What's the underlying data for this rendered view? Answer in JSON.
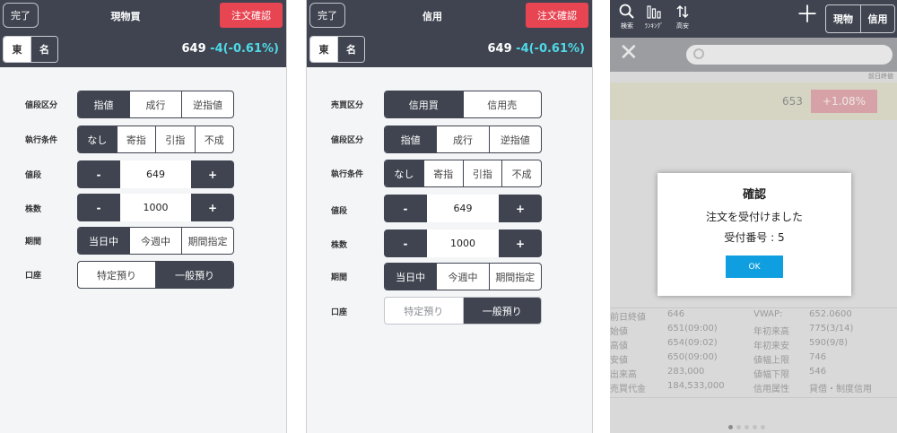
{
  "screen1": {
    "done": "完了",
    "title": "現物買",
    "confirm": "注文確認",
    "exchange": {
      "tse": "東",
      "nse": "名"
    },
    "price": {
      "last": "649",
      "change": "-4(-0.61%)"
    },
    "labels": {
      "price_type": "値段区分",
      "condition": "執行条件",
      "price": "値段",
      "quantity": "株数",
      "period": "期間",
      "account": "口座"
    },
    "price_type": [
      "指値",
      "成行",
      "逆指値"
    ],
    "condition": [
      "なし",
      "寄指",
      "引指",
      "不成"
    ],
    "price_value": "649",
    "quantity_value": "1000",
    "minus": "-",
    "plus": "+",
    "period": [
      "当日中",
      "今週中",
      "期間指定"
    ],
    "account": [
      "特定預り",
      "一般預り"
    ]
  },
  "screen2": {
    "done": "完了",
    "title": "信用",
    "confirm": "注文確認",
    "exchange": {
      "tse": "東",
      "nse": "名"
    },
    "price": {
      "last": "649",
      "change": "-4(-0.61%)"
    },
    "labels": {
      "side": "売買区分",
      "price_type": "値段区分",
      "condition": "執行条件",
      "price": "値段",
      "quantity": "株数",
      "period": "期間",
      "account": "口座"
    },
    "side": [
      "信用買",
      "信用売"
    ],
    "price_type": [
      "指値",
      "成行",
      "逆指値"
    ],
    "condition": [
      "なし",
      "寄指",
      "引指",
      "不成"
    ],
    "price_value": "649",
    "quantity_value": "1000",
    "minus": "-",
    "plus": "+",
    "period": [
      "当日中",
      "今週中",
      "期間指定"
    ],
    "account": [
      "特定預り",
      "一般預り"
    ]
  },
  "screen3": {
    "toolbar": {
      "search": "検索",
      "ranking": "ﾗﾝｷﾝｸﾞ",
      "highlow": "高安"
    },
    "tabs": [
      "現物",
      "信用"
    ],
    "tiny_label": "前日終値",
    "quote": {
      "price": "653",
      "change": "+1.08%"
    },
    "dialog": {
      "title": "確認",
      "line1": "注文を受付けました",
      "line2": "受付番号 : 5",
      "ok": "OK"
    },
    "stats": [
      {
        "label": "前日終値",
        "value": "646",
        "label2": "VWAP:",
        "value2": "652.0600"
      },
      {
        "label": "始値",
        "value": "651(09:00)",
        "label2": "年初来高",
        "value2": "775(3/14)"
      },
      {
        "label": "高値",
        "value": "654(09:02)",
        "label2": "年初来安",
        "value2": "590(9/8)"
      },
      {
        "label": "安値",
        "value": "650(09:00)",
        "label2": "値幅上限",
        "value2": "746"
      },
      {
        "label": "出来高",
        "value": "283,000",
        "label2": "値幅下限",
        "value2": "546"
      },
      {
        "label": "売買代金",
        "value": "184,533,000",
        "label2": "信用属性",
        "value2": "貸借・制度信用"
      }
    ]
  }
}
